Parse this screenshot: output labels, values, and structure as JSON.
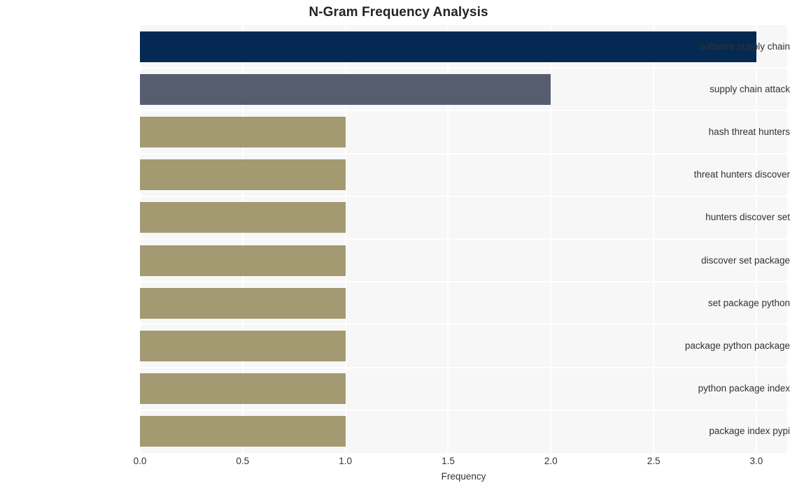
{
  "chart_data": {
    "type": "bar",
    "orientation": "horizontal",
    "title": "N-Gram Frequency Analysis",
    "xlabel": "Frequency",
    "ylabel": "",
    "xlim": [
      0,
      3.15
    ],
    "xticks": [
      "0.0",
      "0.5",
      "1.0",
      "1.5",
      "2.0",
      "2.5",
      "3.0"
    ],
    "xtick_values": [
      0,
      0.5,
      1.0,
      1.5,
      2.0,
      2.5,
      3.0
    ],
    "grid": true,
    "legend": "none",
    "categories": [
      "software supply chain",
      "supply chain attack",
      "hash threat hunters",
      "threat hunters discover",
      "hunters discover set",
      "discover set package",
      "set package python",
      "package python package",
      "python package index",
      "package index pypi"
    ],
    "values": [
      3,
      2,
      1,
      1,
      1,
      1,
      1,
      1,
      1,
      1
    ],
    "bar_colors": [
      "#042952",
      "#565d6f",
      "#a39a72",
      "#a39a72",
      "#a39a72",
      "#a39a72",
      "#a39a72",
      "#a39a72",
      "#a39a72",
      "#a39a72"
    ]
  },
  "style": {
    "figure_background": "#ffffff",
    "plot_background": "#f7f7f7",
    "gridline_color": "#ffffff",
    "title_color": "#232323",
    "tick_label_color": "#333333"
  }
}
